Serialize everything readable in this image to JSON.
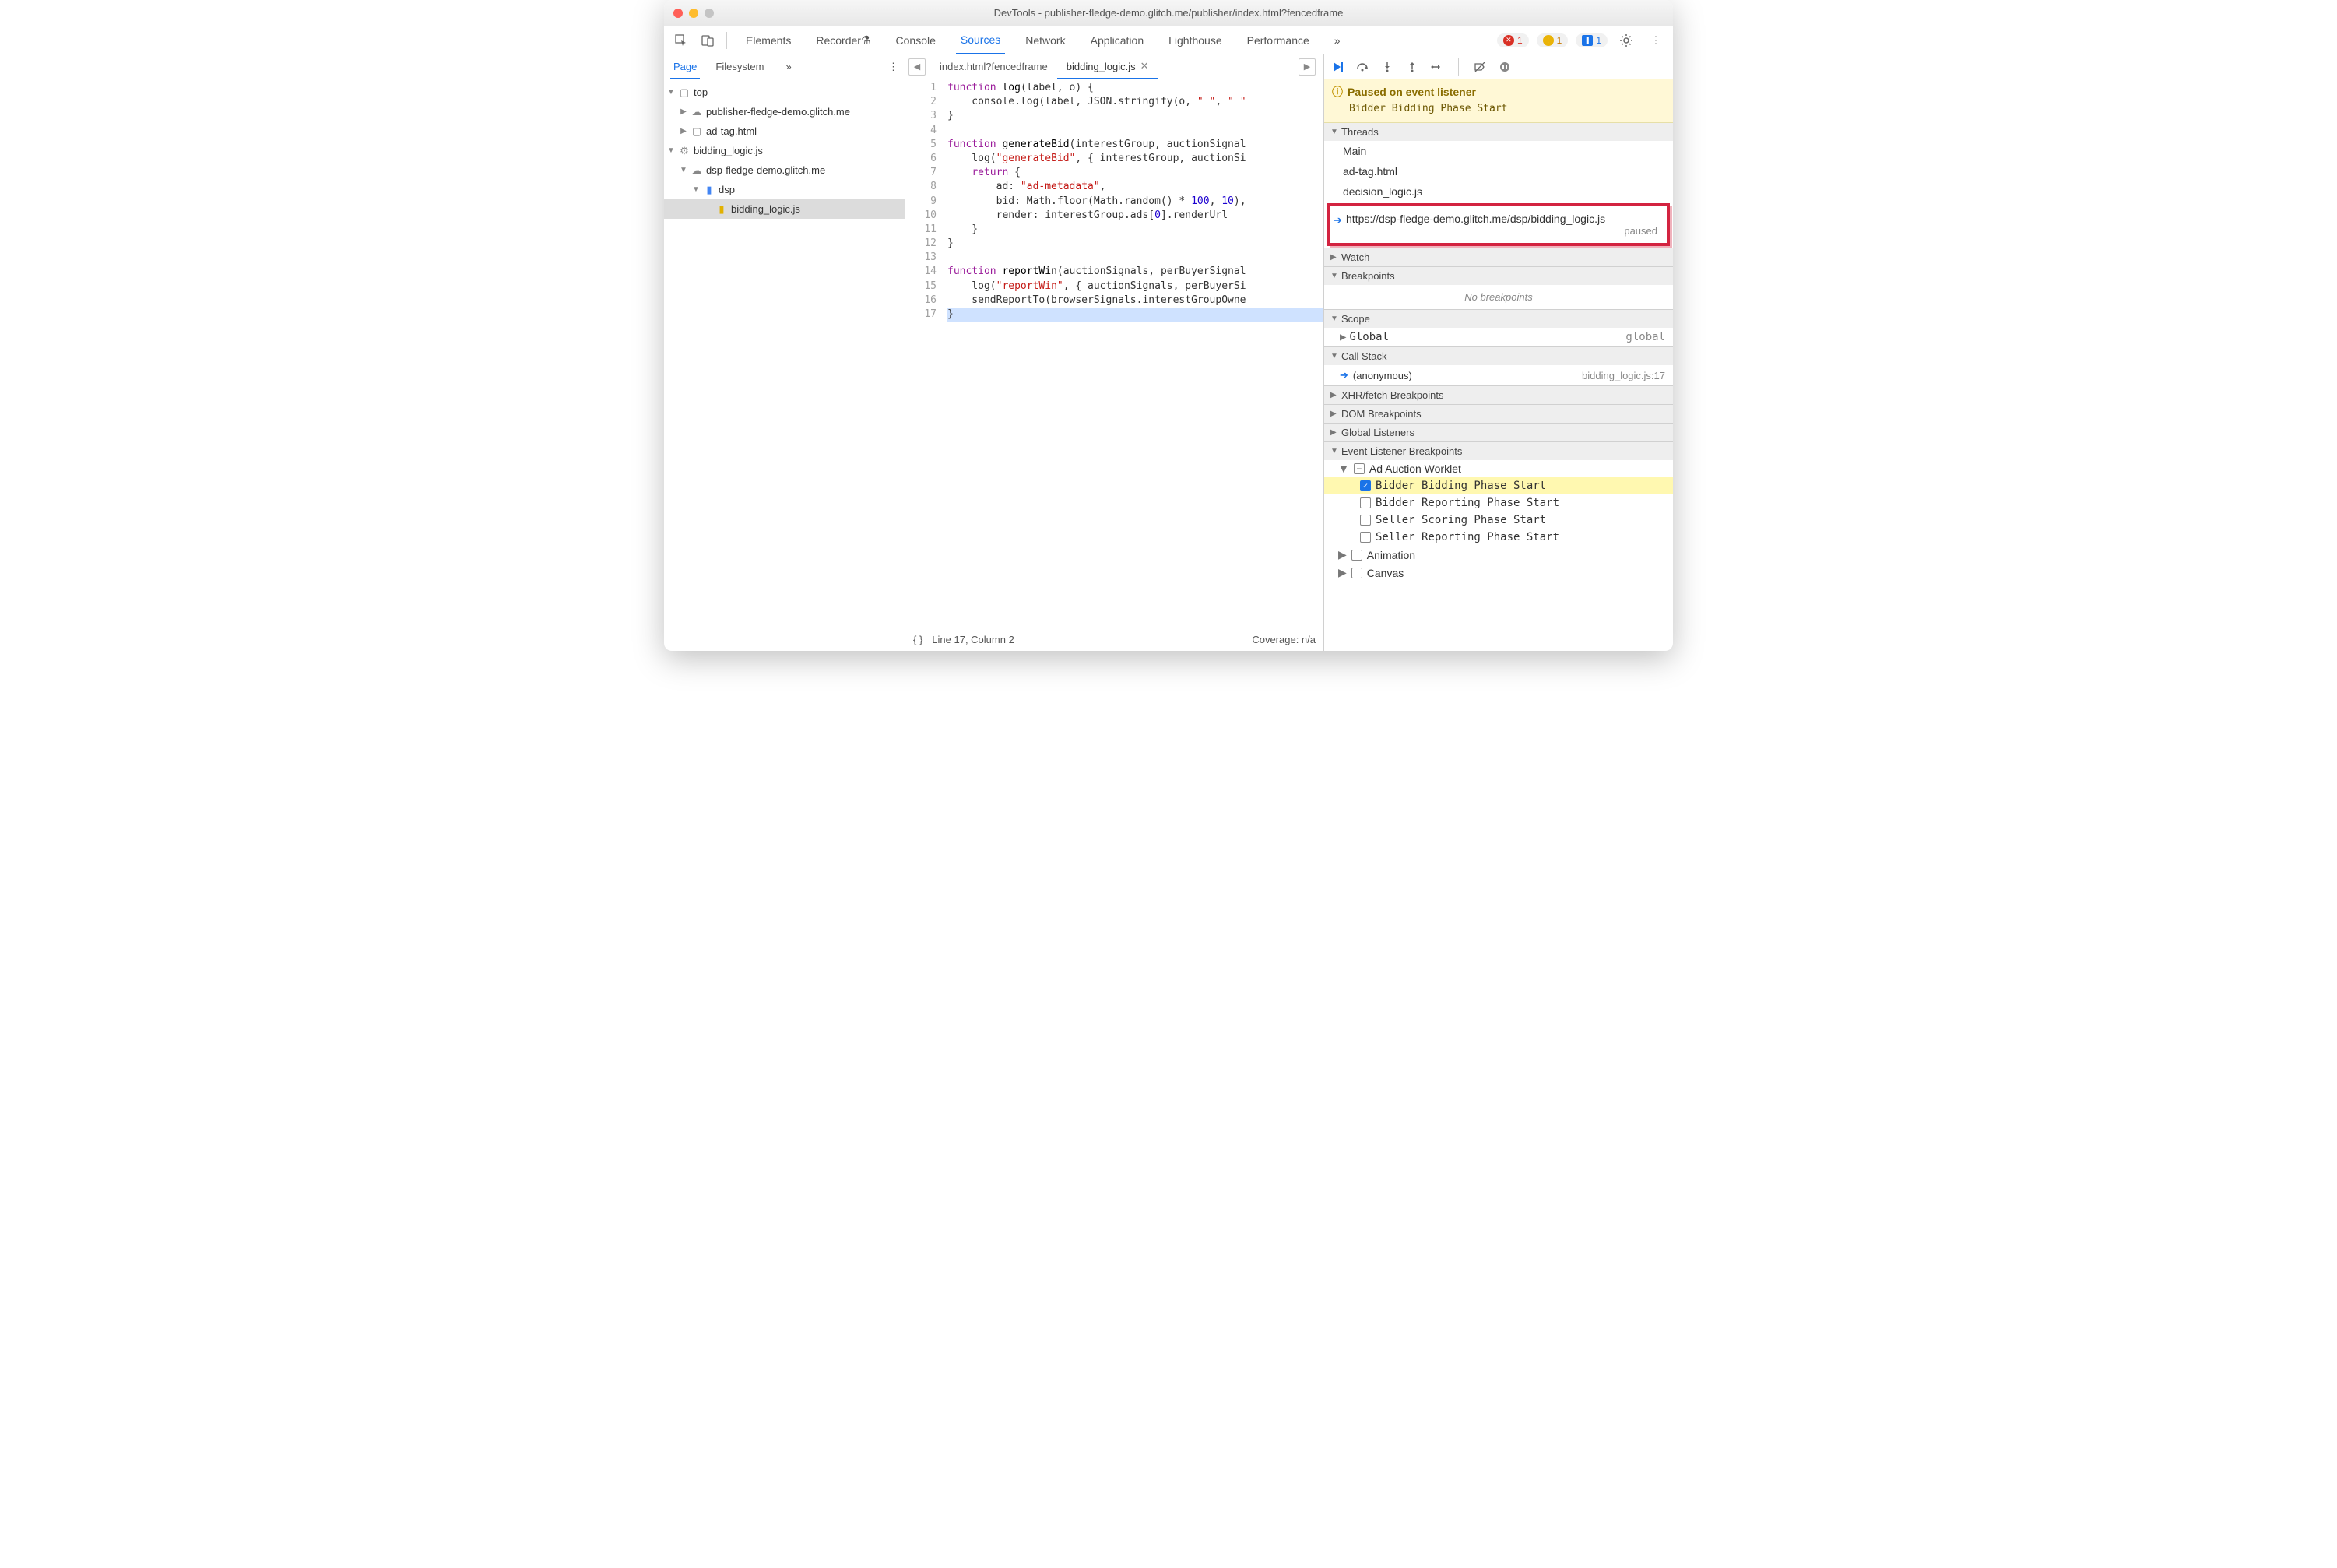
{
  "window": {
    "title": "DevTools - publisher-fledge-demo.glitch.me/publisher/index.html?fencedframe"
  },
  "mainTabs": [
    "Elements",
    "Recorder",
    "Console",
    "Sources",
    "Network",
    "Application",
    "Lighthouse",
    "Performance"
  ],
  "mainTabActive": "Sources",
  "badges": {
    "errors": "1",
    "warnings": "1",
    "issues": "1"
  },
  "leftTabs": {
    "page": "Page",
    "filesystem": "Filesystem"
  },
  "tree": {
    "top": "top",
    "pub": "publisher-fledge-demo.glitch.me",
    "adtag": "ad-tag.html",
    "bl": "bidding_logic.js",
    "dsp_origin": "dsp-fledge-demo.glitch.me",
    "dsp_folder": "dsp",
    "dsp_file": "bidding_logic.js"
  },
  "editor": {
    "tab1": "index.html?fencedframe",
    "tab2": "bidding_logic.js",
    "status_line": "Line 17, Column 2",
    "coverage": "Coverage: n/a"
  },
  "code": {
    "l1a": "function",
    "l1b": " log",
    "l1c": "(label, o) {",
    "l2": "    console.log(label, JSON.stringify(o, ",
    "l2s": "\" \"",
    "l2c": ", ",
    "l2s2": "\" \"",
    "l3": "}",
    "l5a": "function",
    "l5b": " generateBid",
    "l5c": "(interestGroup, auctionSignal",
    "l6": "    log(",
    "l6s": "\"generateBid\"",
    "l6c": ", { interestGroup, auctionSi",
    "l7": "    ",
    "l7k": "return",
    "l7c": " {",
    "l8": "        ad: ",
    "l8s": "\"ad-metadata\"",
    "l8c": ",",
    "l9": "        bid: Math.floor(Math.random() * ",
    "l9n1": "100",
    "l9c": ", ",
    "l9n2": "10",
    "l9c2": "),",
    "l10": "        render: interestGroup.ads[",
    "l10n": "0",
    "l10c": "].renderUrl",
    "l11": "    }",
    "l12": "}",
    "l14a": "function",
    "l14b": " reportWin",
    "l14c": "(auctionSignals, perBuyerSignal",
    "l15": "    log(",
    "l15s": "\"reportWin\"",
    "l15c": ", { auctionSignals, perBuyerSi",
    "l16": "    sendReportTo(browserSignals.interestGroupOwne",
    "l17": "}"
  },
  "paused": {
    "title": "Paused on event listener",
    "sub": "Bidder Bidding Phase Start"
  },
  "sections": {
    "threads": "Threads",
    "watch": "Watch",
    "breakpoints": "Breakpoints",
    "scope": "Scope",
    "callstack": "Call Stack",
    "xhr": "XHR/fetch Breakpoints",
    "dom": "DOM Breakpoints",
    "global": "Global Listeners",
    "evl": "Event Listener Breakpoints"
  },
  "threads": {
    "main": "Main",
    "adtag": "ad-tag.html",
    "decision": "decision_logic.js",
    "dspurl": "https://dsp-fledge-demo.glitch.me/dsp/bidding_logic.js",
    "paused": "paused"
  },
  "nobp": "No breakpoints",
  "scope": {
    "global": "Global",
    "globalval": "global"
  },
  "callstack": {
    "anon": "(anonymous)",
    "loc": "bidding_logic.js:17"
  },
  "evl": {
    "cat1": "Ad Auction Worklet",
    "c1": "Bidder Bidding Phase Start",
    "c2": "Bidder Reporting Phase Start",
    "c3": "Seller Scoring Phase Start",
    "c4": "Seller Reporting Phase Start",
    "cat2": "Animation",
    "cat3": "Canvas"
  }
}
